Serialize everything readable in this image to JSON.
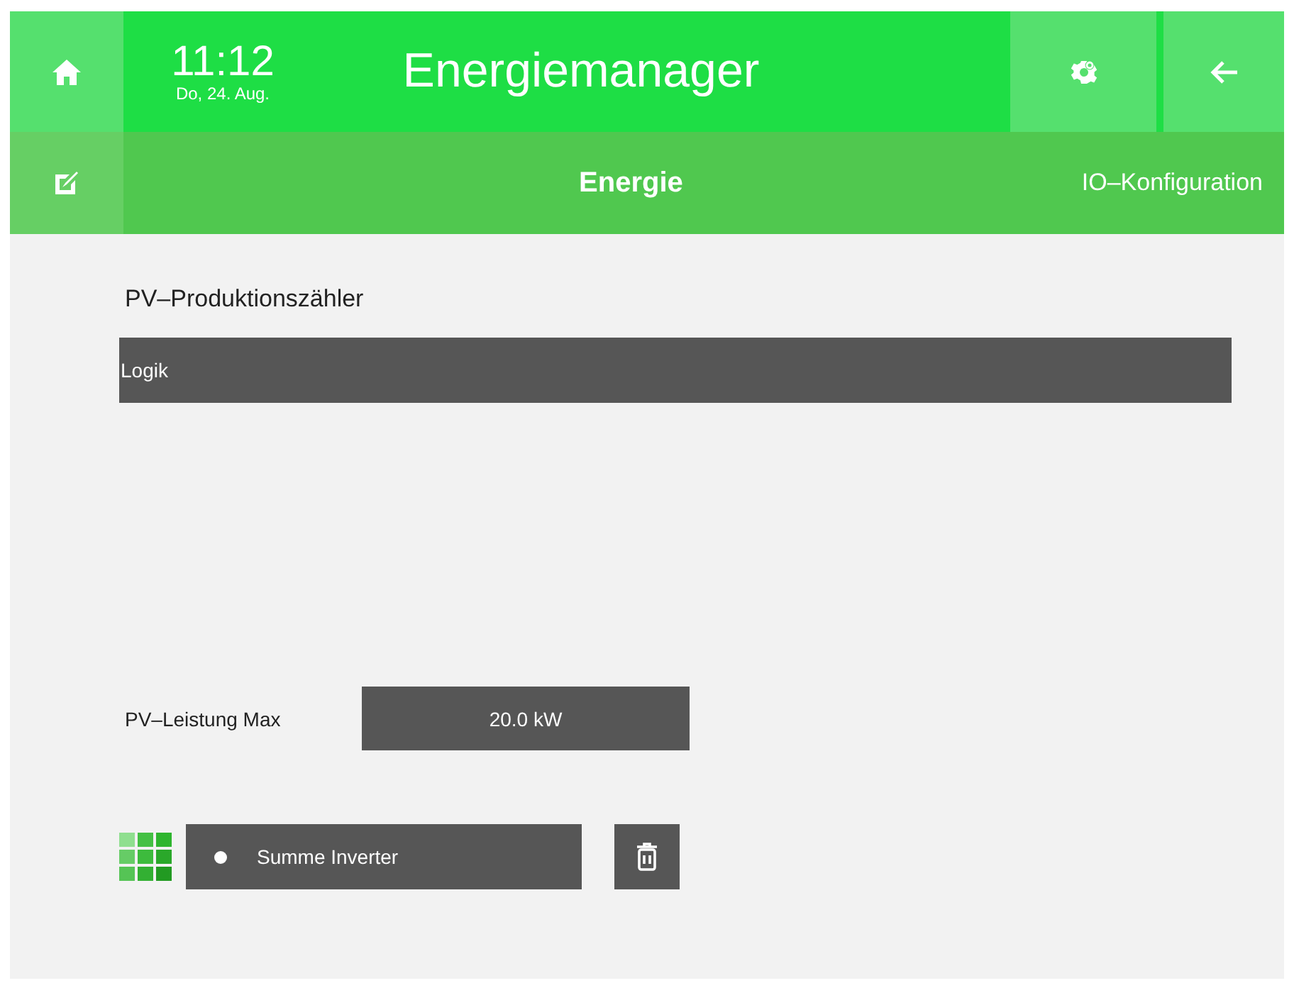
{
  "header": {
    "time": "11:12",
    "date": "Do, 24. Aug.",
    "title": "Energiemanager"
  },
  "subbar": {
    "title": "Energie",
    "right_link": "IO–Konfiguration"
  },
  "section_title": "PV–Produktionszähler",
  "logic_bar": {
    "label": "Logik"
  },
  "max_power": {
    "label": "PV–Leistung Max",
    "value": "20.0 kW"
  },
  "sources": [
    {
      "label": "Summe Inverter"
    }
  ]
}
